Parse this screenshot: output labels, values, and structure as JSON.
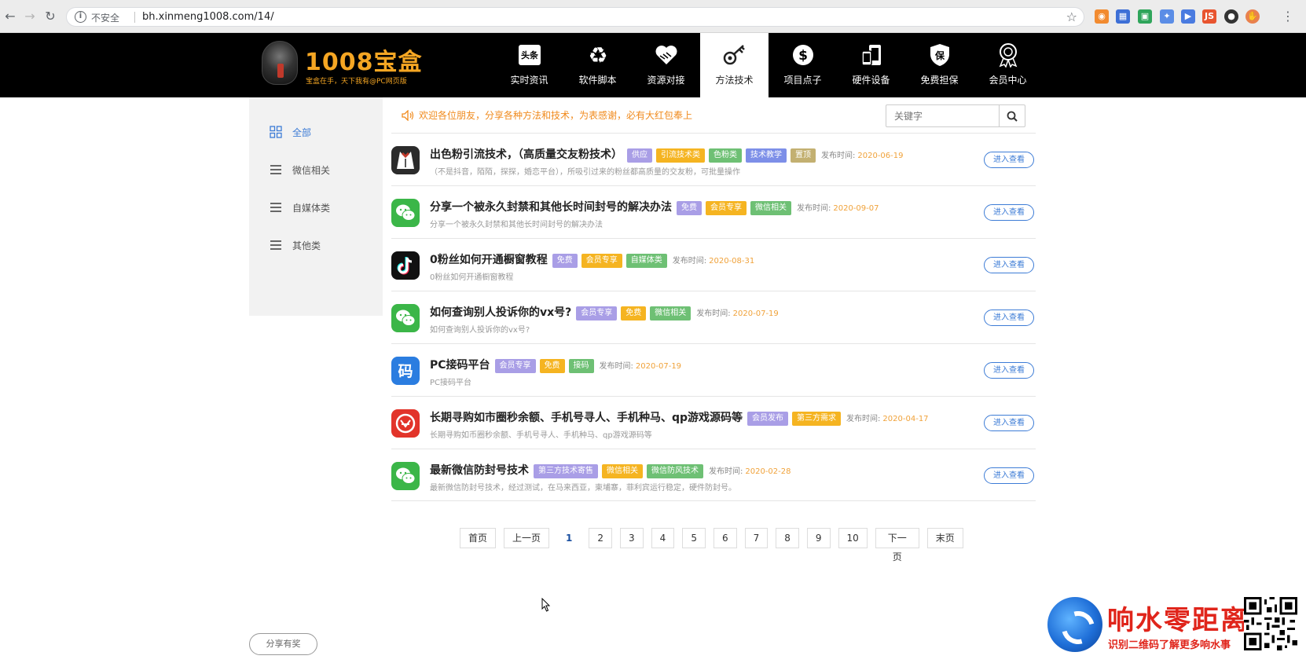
{
  "browser": {
    "security_label": "不安全",
    "url": "bh.xinmeng1008.com/14/"
  },
  "site": {
    "logo_title": "1008宝盒",
    "logo_subtitle": "宝盒在手，天下我有@PC网页版",
    "nav": [
      {
        "label": "实时资讯",
        "icon": "toutiao-icon"
      },
      {
        "label": "软件脚本",
        "icon": "recycle-icon"
      },
      {
        "label": "资源对接",
        "icon": "handshake-icon"
      },
      {
        "label": "方法技术",
        "icon": "key-icon",
        "active": true
      },
      {
        "label": "项目点子",
        "icon": "dollar-icon"
      },
      {
        "label": "硬件设备",
        "icon": "devices-icon"
      },
      {
        "label": "免费担保",
        "icon": "shield-icon"
      },
      {
        "label": "会员中心",
        "icon": "medal-icon"
      }
    ]
  },
  "sidebar": {
    "items": [
      {
        "label": "全部",
        "active": true
      },
      {
        "label": "微信相关"
      },
      {
        "label": "自媒体类"
      },
      {
        "label": "其他类"
      }
    ]
  },
  "notice": "欢迎各位朋友，分享各种方法和技术，为表感谢，必有大红包奉上",
  "search": {
    "placeholder": "关键字"
  },
  "pub_label": "发布时间:",
  "enter_label": "进入查看",
  "posts": [
    {
      "icon": "tuxedo-icon",
      "title": "出色粉引流技术，（高质量交友粉技术）",
      "tags": [
        {
          "t": "供应",
          "c": "purple"
        },
        {
          "t": "引流技术类",
          "c": "orange"
        },
        {
          "t": "色粉类",
          "c": "green"
        },
        {
          "t": "技术教学",
          "c": "blue"
        },
        {
          "t": "置顶",
          "c": "olive"
        }
      ],
      "date": "2020-06-19",
      "desc": "（不是抖音，陌陌，探探，婚恋平台），所吸引过来的粉丝都高质量的交友粉，可批量操作"
    },
    {
      "icon": "wechat-icon",
      "title": "分享一个被永久封禁和其他长时间封号的解决办法",
      "tags": [
        {
          "t": "免费",
          "c": "purple"
        },
        {
          "t": "会员专享",
          "c": "orange"
        },
        {
          "t": "微信相关",
          "c": "green"
        }
      ],
      "date": "2020-09-07",
      "desc": "分享一个被永久封禁和其他长时间封号的解决办法"
    },
    {
      "icon": "tiktok-icon",
      "title": "0粉丝如何开通橱窗教程",
      "tags": [
        {
          "t": "免费",
          "c": "purple"
        },
        {
          "t": "会员专享",
          "c": "orange"
        },
        {
          "t": "自媒体类",
          "c": "green"
        }
      ],
      "date": "2020-08-31",
      "desc": "0粉丝如何开通橱窗教程"
    },
    {
      "icon": "wechat-icon",
      "title": "如何查询别人投诉你的vx号?",
      "tags": [
        {
          "t": "会员专享",
          "c": "purple"
        },
        {
          "t": "免费",
          "c": "orange"
        },
        {
          "t": "微信相关",
          "c": "green"
        }
      ],
      "date": "2020-07-19",
      "desc": "如何查询别人投诉你的vx号?"
    },
    {
      "icon": "code-icon",
      "title": "PC接码平台",
      "tags": [
        {
          "t": "会员专享",
          "c": "purple"
        },
        {
          "t": "免费",
          "c": "orange"
        },
        {
          "t": "接码",
          "c": "green"
        }
      ],
      "date": "2020-07-19",
      "desc": "PC接码平台"
    },
    {
      "icon": "coin-icon",
      "title": "长期寻购如市圈秒余额、手机号寻人、手机种马、qp游戏源码等",
      "tags": [
        {
          "t": "会员发布",
          "c": "purple"
        },
        {
          "t": "第三方需求",
          "c": "orange"
        }
      ],
      "date": "2020-04-17",
      "desc": "长期寻购如币圈秒余额、手机号寻人、手机种马、qp游戏源码等"
    },
    {
      "icon": "wechat-icon",
      "title": "最新微信防封号技术",
      "tags": [
        {
          "t": "第三方技术寄售",
          "c": "purple"
        },
        {
          "t": "微信相关",
          "c": "orange"
        },
        {
          "t": "微信防风技术",
          "c": "green"
        }
      ],
      "date": "2020-02-28",
      "desc": "最新微信防封号技术，经过测试，在马来西亚，柬埔寨，菲利宾运行稳定，硬件防封号。"
    }
  ],
  "pagination": {
    "first": "首页",
    "prev": "上一页",
    "pages": [
      "1",
      "2",
      "3",
      "4",
      "5",
      "6",
      "7",
      "8",
      "9",
      "10"
    ],
    "current": "1",
    "next": "下一页",
    "last": "末页"
  },
  "share_label": "分享有奖",
  "watermark": {
    "title": "响水零距离",
    "subtitle": "识别二维码了解更多响水事"
  }
}
